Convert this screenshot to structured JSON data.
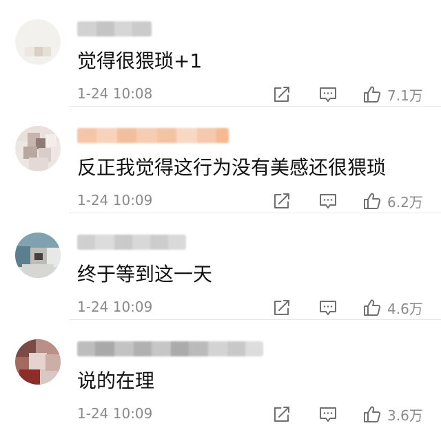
{
  "comments": [
    {
      "text": "觉得很猥琐+1",
      "time": "1-24 10:08",
      "likes": "7.1万"
    },
    {
      "text": "反正我觉得这行为没有美感还很猥琐",
      "time": "1-24 10:09",
      "likes": "6.2万"
    },
    {
      "text": "终于等到这一天",
      "time": "1-24 10:09",
      "likes": "4.6万"
    },
    {
      "text": "说的在理",
      "time": "1-24 10:09",
      "likes": "3.6万"
    }
  ],
  "icons": {
    "repost": "repost-icon",
    "reply": "comment-icon",
    "like": "thumbs-up-icon"
  },
  "colors": {
    "text": "#111111",
    "meta": "#8a8a8a",
    "icon": "#6f6f6f",
    "divider": "#e8e8e8"
  }
}
